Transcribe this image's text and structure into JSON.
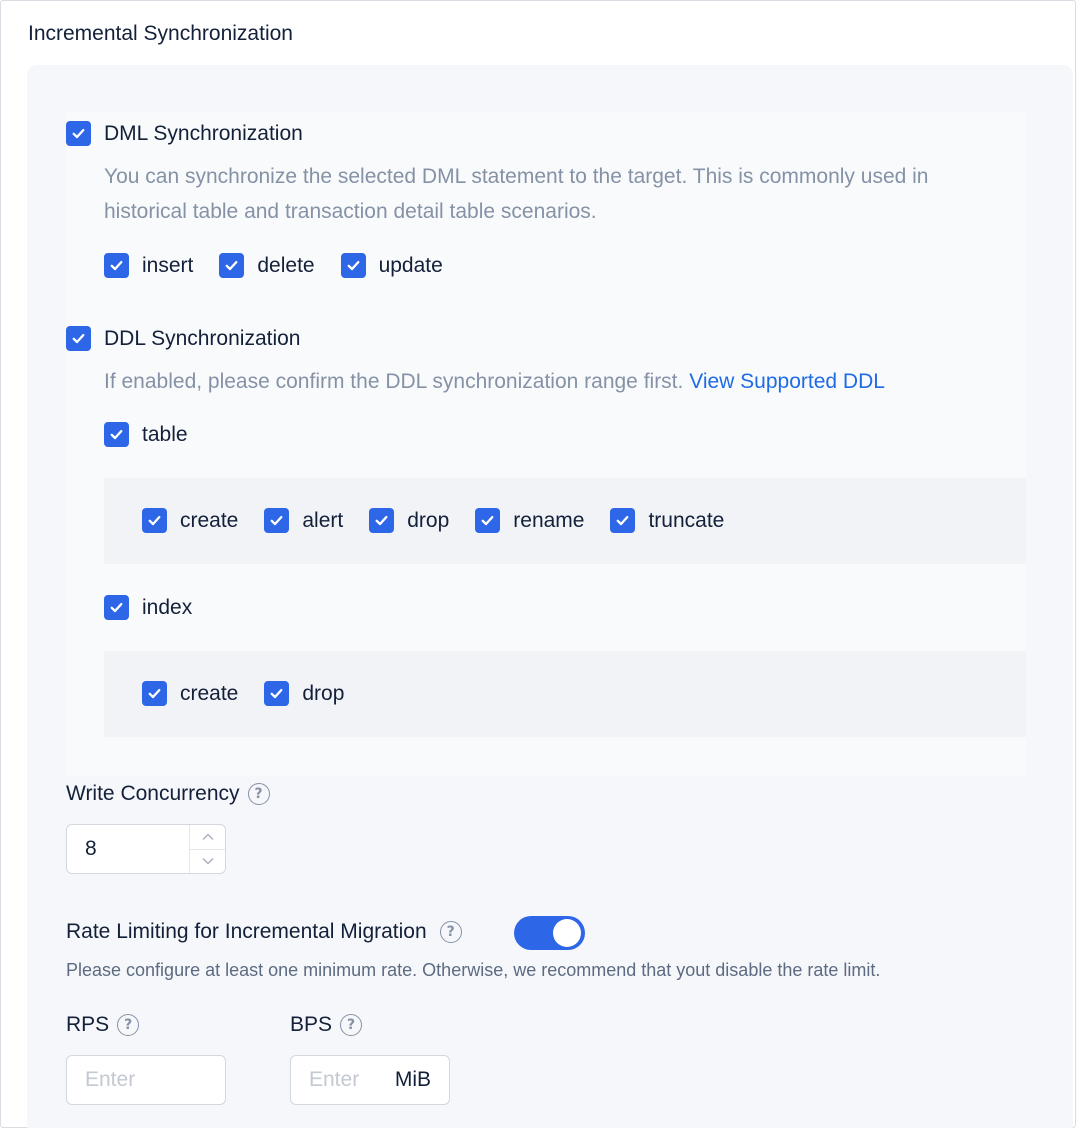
{
  "section": {
    "title": "Incremental Synchronization"
  },
  "dml": {
    "label": "DML Synchronization",
    "checked": true,
    "description_line1": "You can synchronize the selected DML statement to the target. This is commonly used in",
    "description_line2": "historical table and transaction detail table scenarios.",
    "options": [
      {
        "label": "insert",
        "checked": true
      },
      {
        "label": "delete",
        "checked": true
      },
      {
        "label": "update",
        "checked": true
      }
    ]
  },
  "ddl": {
    "label": "DDL Synchronization",
    "checked": true,
    "description": "If enabled, please confirm the DDL synchronization range first.",
    "link": "View Supported DDL",
    "table": {
      "label": "table",
      "checked": true,
      "options": [
        {
          "label": "create",
          "checked": true
        },
        {
          "label": "alert",
          "checked": true
        },
        {
          "label": "drop",
          "checked": true
        },
        {
          "label": "rename",
          "checked": true
        },
        {
          "label": "truncate",
          "checked": true
        }
      ]
    },
    "index": {
      "label": "index",
      "checked": true,
      "options": [
        {
          "label": "create",
          "checked": true
        },
        {
          "label": "drop",
          "checked": true
        }
      ]
    }
  },
  "write_concurrency": {
    "label": "Write Concurrency",
    "value": "8"
  },
  "rate_limit": {
    "label": "Rate Limiting for Incremental Migration",
    "enabled": true,
    "hint": "Please configure at least one minimum rate. Otherwise, we recommend that yout disable the rate limit."
  },
  "rps": {
    "label": "RPS",
    "placeholder": "Enter"
  },
  "bps": {
    "label": "BPS",
    "placeholder": "Enter",
    "unit": "MiB"
  },
  "colors": {
    "accent": "#2d66e6",
    "link": "#1f6be6",
    "muted": "#8592a6"
  },
  "icons": {
    "check": "check-icon",
    "help": "question-circle-icon",
    "up": "chevron-up-icon",
    "down": "chevron-down-icon"
  }
}
